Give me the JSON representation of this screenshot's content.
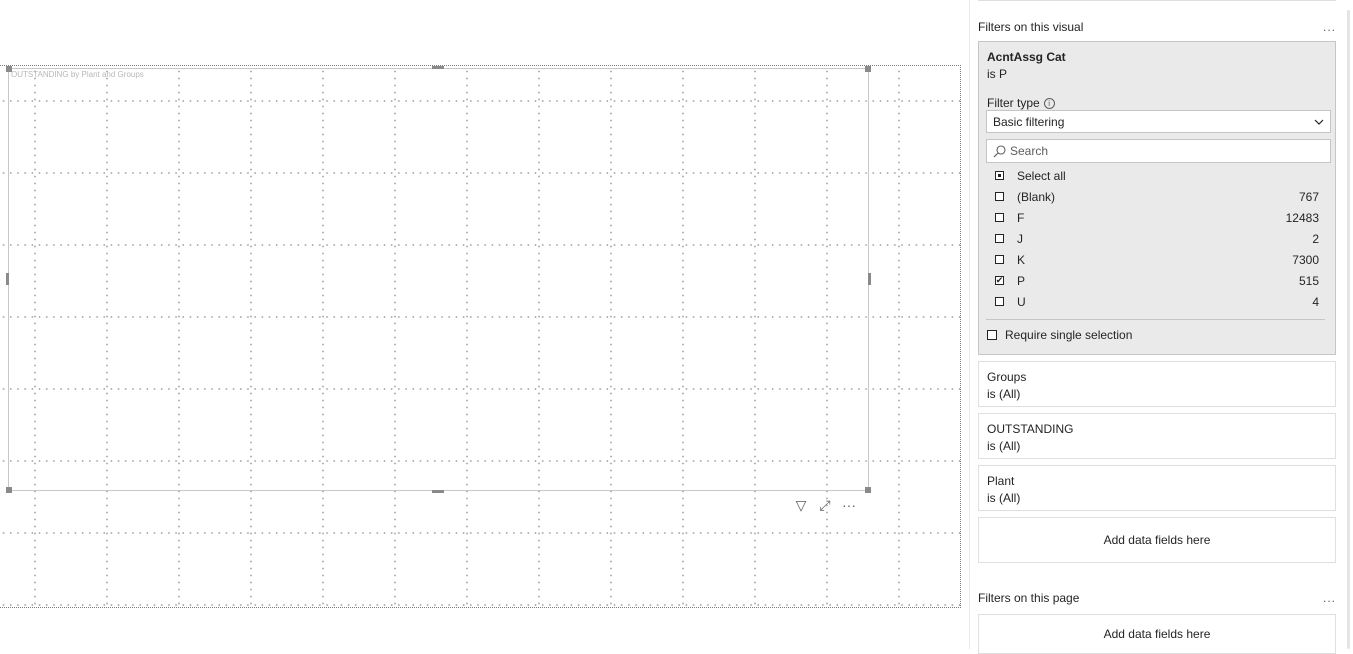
{
  "visual": {
    "title": "OUTSTANDING by Plant and Groups",
    "toolbar": [
      {
        "name": "filter-icon",
        "glyph": "▽"
      },
      {
        "name": "focus-mode-icon",
        "glyph": "⤢"
      },
      {
        "name": "more-options-icon",
        "glyph": "···"
      }
    ]
  },
  "filters_visual": {
    "heading": "Filters on this visual",
    "more": "...",
    "expanded_card": {
      "name": "AcntAssg Cat",
      "value": "is P",
      "filter_type_label": "Filter type",
      "filter_type_value": "Basic filtering",
      "search_placeholder": "Search",
      "options": [
        {
          "label": "Select all",
          "count": "",
          "state": "partial"
        },
        {
          "label": "(Blank)",
          "count": "767",
          "state": "unchecked"
        },
        {
          "label": "F",
          "count": "12483",
          "state": "unchecked"
        },
        {
          "label": "J",
          "count": "2",
          "state": "unchecked"
        },
        {
          "label": "K",
          "count": "7300",
          "state": "unchecked"
        },
        {
          "label": "P",
          "count": "515",
          "state": "checked"
        },
        {
          "label": "U",
          "count": "4",
          "state": "unchecked"
        }
      ],
      "require_single": "Require single selection"
    },
    "cards": [
      {
        "name": "Groups",
        "value": "is (All)"
      },
      {
        "name": "OUTSTANDING",
        "value": "is (All)"
      },
      {
        "name": "Plant",
        "value": "is (All)"
      }
    ],
    "add_fields": "Add data fields here"
  },
  "filters_page": {
    "heading": "Filters on this page",
    "more": "...",
    "add_fields": "Add data fields here"
  }
}
